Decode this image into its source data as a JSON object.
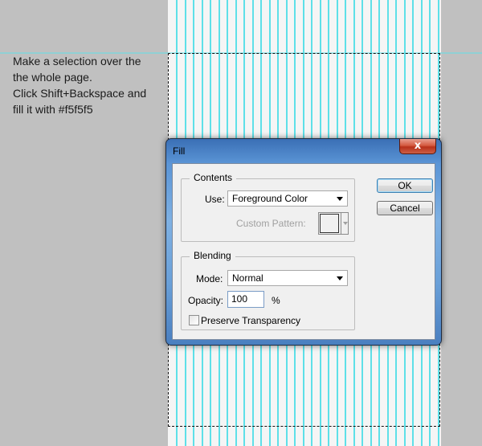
{
  "instructions": [
    "Make a selection over the",
    "the whole page.",
    "Click Shift+Backspace and",
    "fill it with #f5f5f5"
  ],
  "colors": {
    "background": "#c0c0c0",
    "canvas": "#f5f5f5",
    "guide": "#5ee0e8"
  },
  "dialog": {
    "title": "Fill",
    "close_glyph": "x",
    "ok_label": "OK",
    "cancel_label": "Cancel",
    "contents": {
      "legend": "Contents",
      "use_label": "Use:",
      "use_value": "Foreground Color",
      "custom_pattern_label": "Custom Pattern:"
    },
    "blending": {
      "legend": "Blending",
      "mode_label": "Mode:",
      "mode_value": "Normal",
      "opacity_label": "Opacity:",
      "opacity_value": "100",
      "opacity_unit": "%",
      "preserve_label": "Preserve Transparency",
      "preserve_checked": false
    }
  }
}
